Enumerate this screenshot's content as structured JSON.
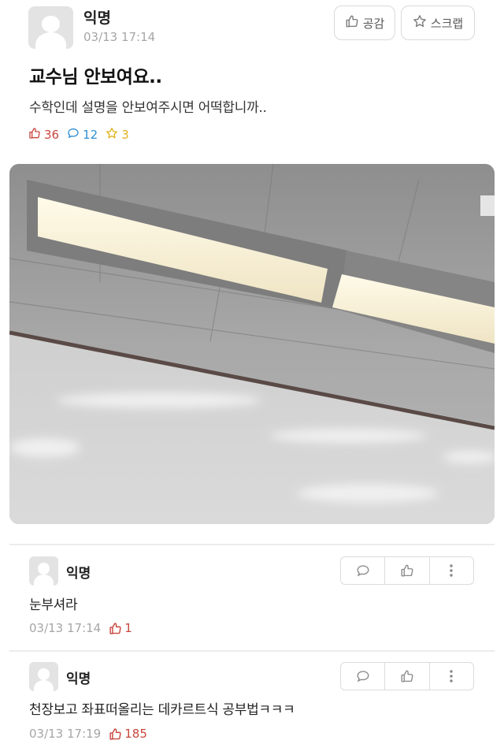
{
  "post": {
    "author": "익명",
    "time": "03/13 17:14",
    "like_button": "공감",
    "scrap_button": "스크랩",
    "title": "교수님 안보여요..",
    "body": "수학인데 설명을 안보여주시면 어떡합니까..",
    "stats": {
      "likes": "36",
      "comments": "12",
      "scraps": "3"
    },
    "colors": {
      "like": "#c9463d",
      "comment": "#2f8fd2",
      "scrap": "#e0b21b"
    }
  },
  "comments": [
    {
      "author": "익명",
      "text": "눈부셔라",
      "time": "03/13 17:14",
      "likes": "1"
    },
    {
      "author": "익명",
      "text": "천장보고 좌표떠올리는 데카르트식 공부법ㅋㅋㅋ",
      "time": "03/13 17:19",
      "likes": "185"
    }
  ]
}
